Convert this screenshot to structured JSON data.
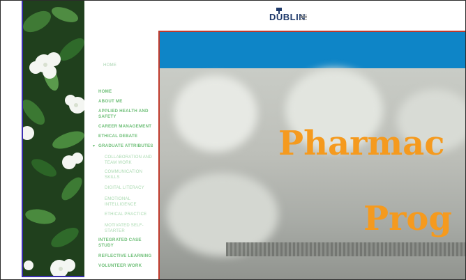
{
  "logo": {
    "text": "DUBLIN"
  },
  "breadcrumb": "HOME",
  "nav": {
    "items": [
      {
        "label": "HOME"
      },
      {
        "label": "ABOUT ME"
      },
      {
        "label": "APPLIED HEALTH AND SAFETY"
      },
      {
        "label": "CAREER MANAGEMENT"
      },
      {
        "label": "ETHICAL DEBATE"
      },
      {
        "label": "GRADUATE ATTRIBUTES"
      },
      {
        "label": "INTEGRATED CASE STUDY"
      },
      {
        "label": "REFLECTIVE LEARNING"
      },
      {
        "label": "VOLUNTEER WORK"
      }
    ],
    "sub_items": [
      {
        "label": "COLLABORATION AND TEAM WORK"
      },
      {
        "label": "COMMUNICATION SKILLS"
      },
      {
        "label": "DIGITAL LITERACY"
      },
      {
        "label": "EMOTIONAL INTELLIGENCE"
      },
      {
        "label": "ETHICAL PRACTICE"
      },
      {
        "label": "MOTIVATED SELF-STARTER"
      }
    ],
    "expanded_caret": "▾"
  },
  "overlay": {
    "title_line1": "Pharmac",
    "title_line2": "Prog",
    "bar_color": "#0e85c7",
    "title_color": "#f59a1e"
  },
  "colors": {
    "nav_text": "#6fbf78",
    "frame": "#3b2fb0"
  }
}
